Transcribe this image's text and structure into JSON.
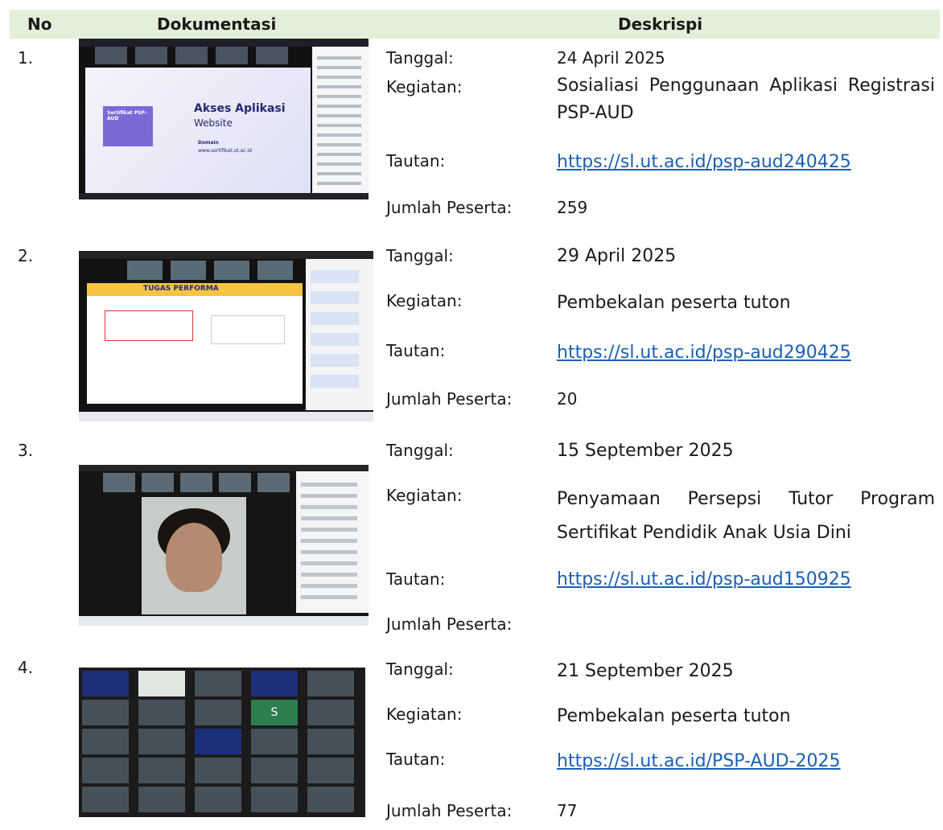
{
  "header": {
    "no": "No",
    "doc": "Dokumentasi",
    "desc": "Deskrispi"
  },
  "labels": {
    "tanggal": "Tanggal:",
    "kegiatan": "Kegiatan:",
    "tautan": "Tautan:",
    "jumlah": "Jumlah Peserta:"
  },
  "rows": [
    {
      "no": "1.",
      "tanggal": "24 April 2025",
      "kegiatan": "Sosialiasi Penggunaan Aplikasi Registrasi PSP-AUD",
      "tautan": "https://sl.ut.ac.id/psp-aud240425",
      "jumlah": "259",
      "thumb": {
        "card": "Sertifikat PSP-AUD",
        "title": "Akses Aplikasi",
        "subtitle": "Website",
        "domain_label": "Domain",
        "domain_url": "www.sertifikat.ut.ac.id"
      }
    },
    {
      "no": "2.",
      "tanggal": "29 April 2025",
      "kegiatan": "Pembekalan peserta tuton",
      "tautan": "https://sl.ut.ac.id/psp-aud290425",
      "jumlah": "20",
      "thumb": {
        "title": "TUGAS PERFORMA"
      }
    },
    {
      "no": "3.",
      "tanggal": "15 September 2025",
      "kegiatan": "Penyamaan Persepsi Tutor Program Sertifikat Pendidik Anak Usia Dini",
      "tautan": "https://sl.ut.ac.id/psp-aud150925",
      "jumlah": ""
    },
    {
      "no": "4.",
      "tanggal": "21 September 2025",
      "kegiatan": "Pembekalan peserta tuton",
      "tautan": "https://sl.ut.ac.id/PSP-AUD-2025",
      "jumlah": "77",
      "thumb": {
        "tile_letter": "S"
      }
    }
  ]
}
